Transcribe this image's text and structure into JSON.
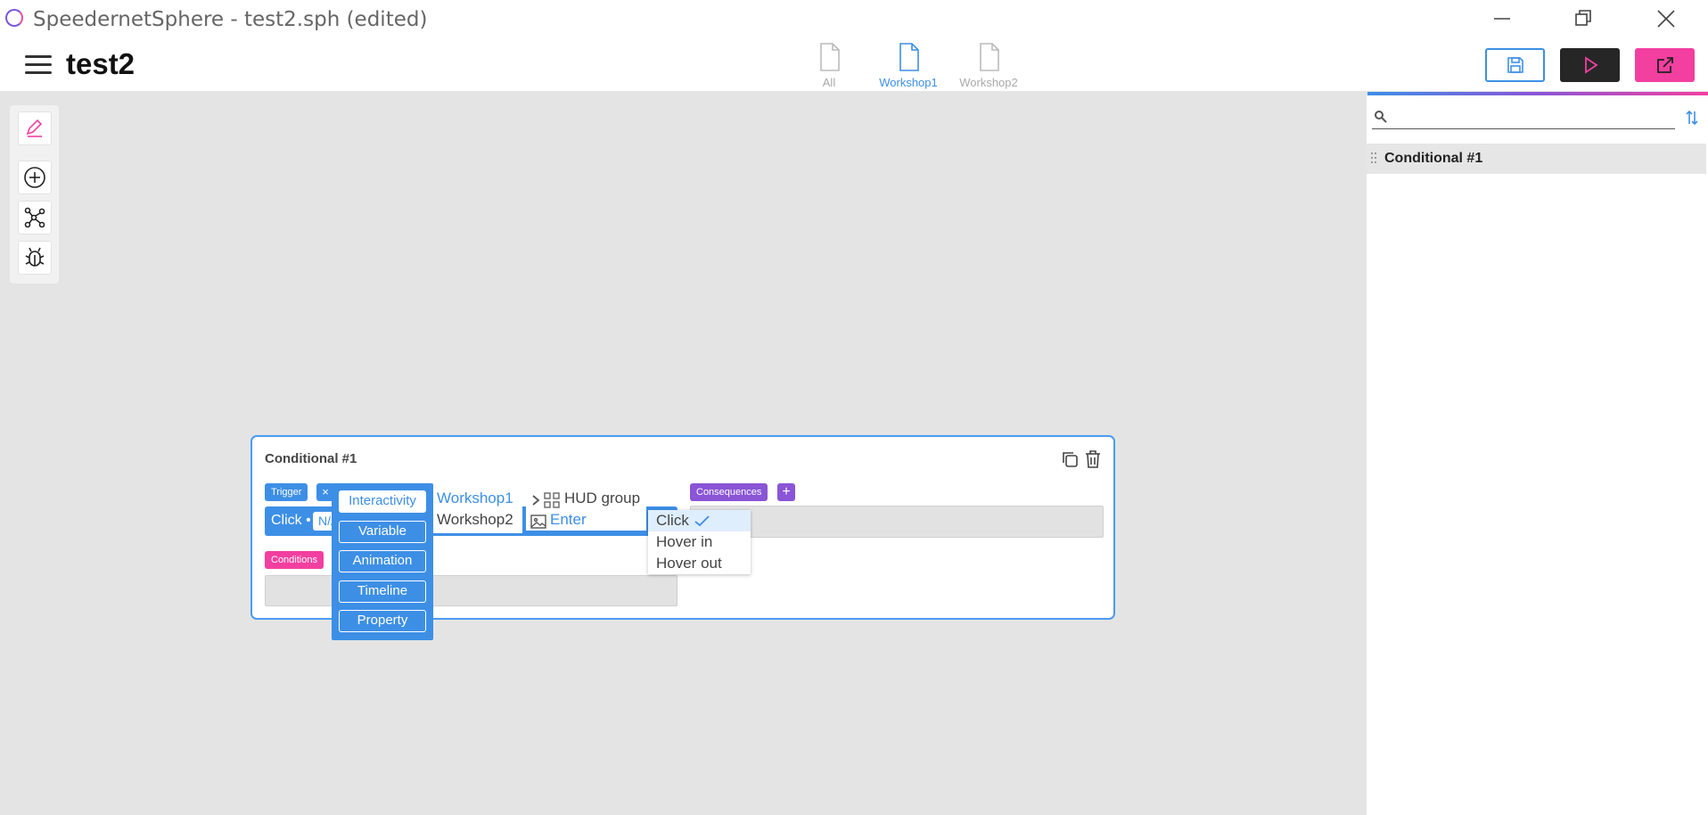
{
  "window": {
    "title": "SpeedernetSphere - test2.sph (edited)"
  },
  "header": {
    "doc_title": "test2",
    "tabs": [
      {
        "label": "All",
        "color": "#aaaaaa"
      },
      {
        "label": "Workshop1",
        "color": "#3d8fe6"
      },
      {
        "label": "Workshop2",
        "color": "#aaaaaa"
      }
    ],
    "active_tab": "Workshop1"
  },
  "colors": {
    "accent_blue": "#3d8fe6",
    "accent_pink": "#f33fa0",
    "accent_purple": "#8a55d6",
    "dark": "#262626"
  },
  "tools": [
    "pencil-icon",
    "add-circle-icon",
    "node-graph-icon",
    "bug-icon"
  ],
  "right_panel": {
    "search_placeholder": "",
    "items": [
      {
        "label": "Conditional #1"
      }
    ]
  },
  "card": {
    "title": "Conditional #1",
    "trigger_label": "Trigger",
    "remove_label": "×",
    "consequences_label": "Consequences",
    "add_label": "+",
    "conditions_label": "Conditions",
    "trigger_text": "Click •",
    "trigger_slot": "N/A"
  },
  "category_menu": {
    "items": [
      "Interactivity",
      "Variable",
      "Animation",
      "Timeline",
      "Property"
    ],
    "active": "Interactivity"
  },
  "workshop_menu": {
    "items": [
      "Workshop1",
      "Workshop2"
    ],
    "active": "Workshop1"
  },
  "object_menu": {
    "items": [
      "HUD group",
      "Enter"
    ],
    "active": "Enter"
  },
  "event_menu": {
    "items": [
      "Click",
      "Hover in",
      "Hover out"
    ],
    "selected": "Click"
  }
}
